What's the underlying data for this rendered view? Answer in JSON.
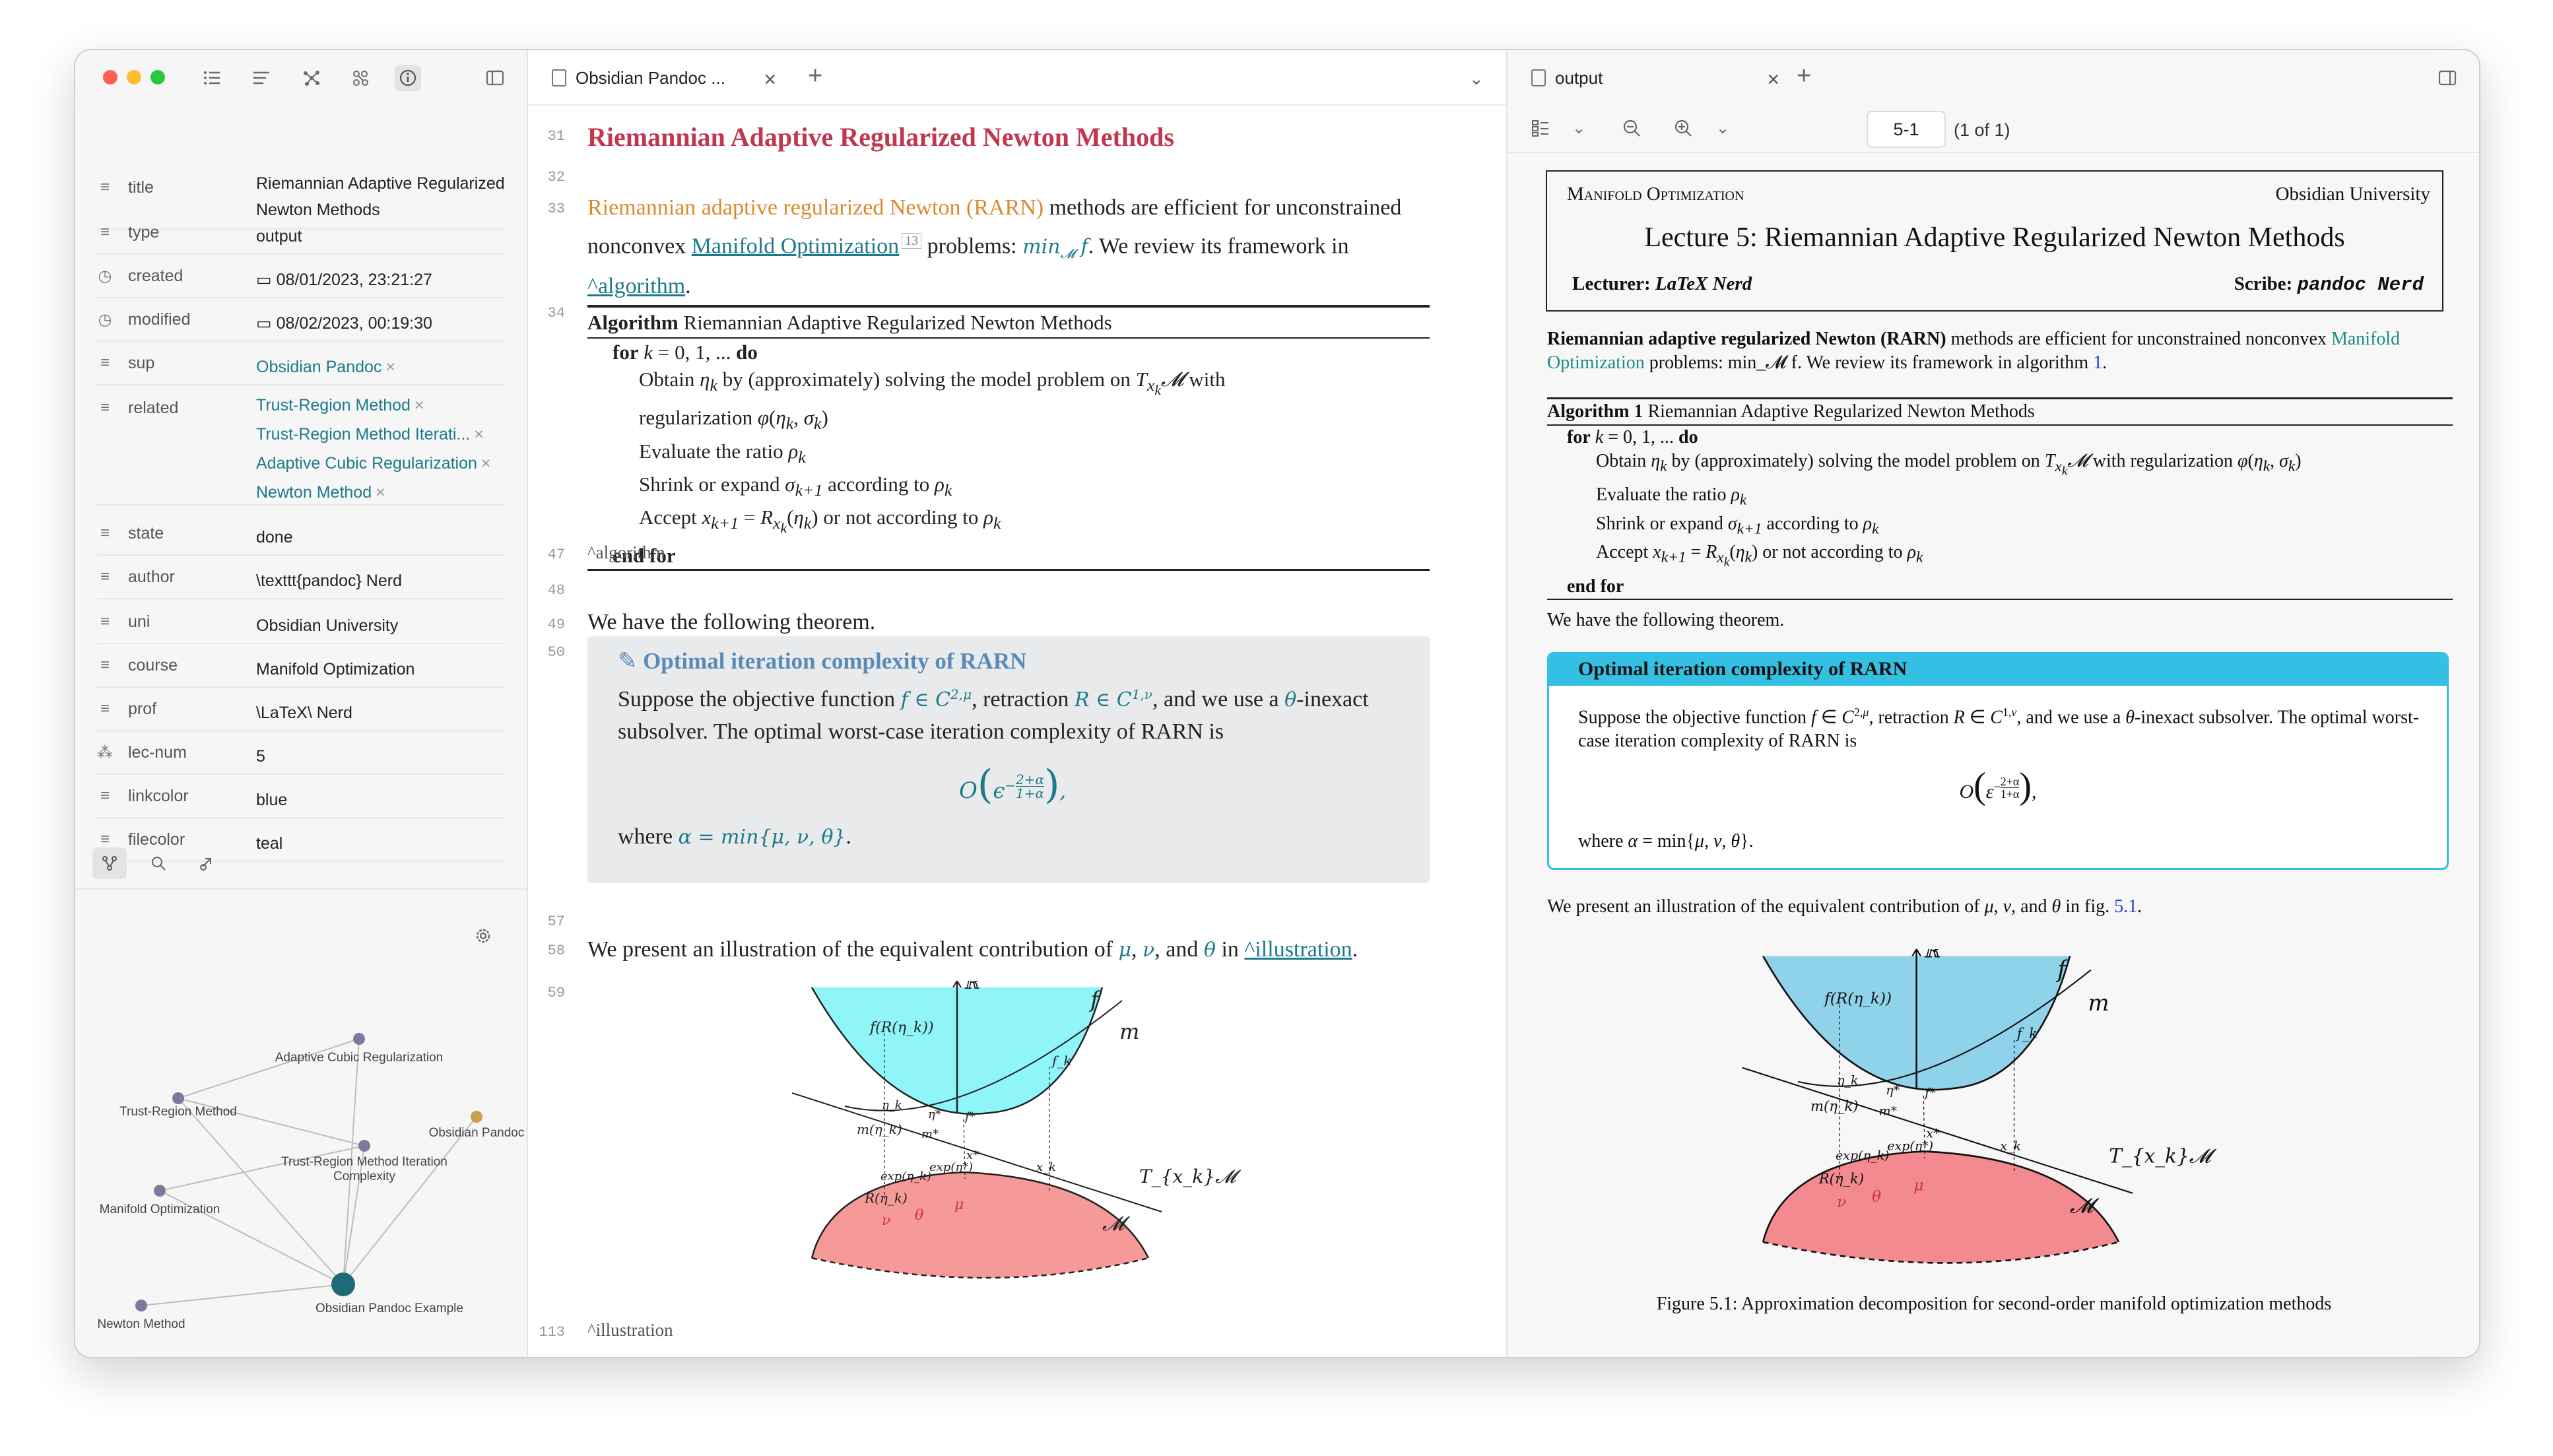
{
  "window": {
    "controls": [
      "close",
      "minimize",
      "zoom"
    ]
  },
  "left_toolbar": {
    "icons": [
      "bullet-list-icon",
      "outline-icon",
      "graph-icon",
      "local-graph-icon",
      "info-icon",
      "sidebar-toggle-icon"
    ]
  },
  "properties": [
    {
      "key": "title",
      "value": "Riemannian Adaptive Regularized Newton Methods",
      "icon": "text-icon"
    },
    {
      "key": "type",
      "value": "output",
      "icon": "text-icon"
    },
    {
      "key": "created",
      "value": "08/01/2023, 23:21:27",
      "icon": "clock-icon"
    },
    {
      "key": "modified",
      "value": "08/02/2023, 00:19:30",
      "icon": "clock-icon"
    },
    {
      "key": "sup",
      "value": "Obsidian Pandoc",
      "icon": "list-icon"
    },
    {
      "key": "related",
      "icon": "list-icon",
      "values": [
        "Trust-Region Method",
        "Trust-Region Method Iterati...",
        "Adaptive Cubic Regularization",
        "Newton Method"
      ]
    },
    {
      "key": "state",
      "value": "done",
      "icon": "text-icon"
    },
    {
      "key": "author",
      "value": "\\texttt{pandoc} Nerd",
      "icon": "text-icon"
    },
    {
      "key": "uni",
      "value": "Obsidian University",
      "icon": "text-icon"
    },
    {
      "key": "course",
      "value": "Manifold Optimization",
      "icon": "text-icon"
    },
    {
      "key": "prof",
      "value": "\\LaTeX\\ Nerd",
      "icon": "text-icon"
    },
    {
      "key": "lec-num",
      "value": "5",
      "icon": "number-icon"
    },
    {
      "key": "linkcolor",
      "value": "blue",
      "icon": "text-icon"
    },
    {
      "key": "filecolor",
      "value": "teal",
      "icon": "text-icon"
    }
  ],
  "graph": {
    "nodes": [
      {
        "label": "Adaptive Cubic Regularization",
        "color": "#7a7a9a"
      },
      {
        "label": "Trust-Region Method",
        "color": "#7a7a9a"
      },
      {
        "label": "Obsidian Pandoc",
        "color": "#c9a04c"
      },
      {
        "label": "Trust-Region Method Iteration Complexity",
        "color": "#7a7a9a"
      },
      {
        "label": "Manifold Optimization",
        "color": "#7a7a9a"
      },
      {
        "label": "Obsidian Pandoc Example",
        "color": "#1d6b78"
      },
      {
        "label": "Newton Method",
        "color": "#7a7a9a"
      }
    ]
  },
  "editor": {
    "tab_title": "Obsidian Pandoc ...",
    "line_numbers": [
      "31",
      "32",
      "33",
      "34",
      "47",
      "48",
      "49",
      "50",
      "57",
      "58",
      "59",
      "113"
    ],
    "heading": "Riemannian Adaptive Regularized Newton Methods",
    "intro_highlight": "Riemannian adaptive regularized Newton (RARN)",
    "intro_rest": " methods are efficient for unconstrained nonconvex ",
    "intro_link": "Manifold Optimization",
    "intro_sup": "13",
    "intro_problems": " problems: ",
    "intro_math": "min",
    "intro_math_sub": "𝓜",
    "intro_f": "f",
    "intro_tail": ". We review its framework in ",
    "intro_ref": "^algorithm",
    "algorithm_label": "Algorithm",
    "algorithm_title": "Riemannian Adaptive Regularized Newton Methods",
    "algo_lines": [
      "for k = 0, 1, ... do",
      "Obtain η_k by (approximately) solving the model problem on T_{x_k}𝓜 with",
      "regularization φ(η_k, σ_k)",
      "Evaluate the ratio ρ_k",
      "Shrink or expand σ_{k+1} according to ρ_k",
      "Accept x_{k+1} = R_{x_k}(η_k) or not according to ρ_k",
      "end for"
    ],
    "algo_anchor": "^algorithm",
    "theorem_intro": "We have the following theorem.",
    "callout_title": "Optimal iteration complexity of RARN",
    "callout_text": "Suppose the objective function f ∈ C^{2,μ}, retraction R ∈ C^{1,ν}, and we use a θ-inexact subsolver. The optimal worst-case iteration complexity of RARN is",
    "callout_formula": "O(ε^{-(2+α)/(1+α)}),",
    "callout_where": "where α = min{μ, ν, θ}.",
    "illustration_text": "We present an illustration of the equivalent contribution of μ, ν, and θ in",
    "illustration_ref": "^illustration",
    "illustration_anchor": "^illustration"
  },
  "figure_labels": {
    "R": "ℝ",
    "f": "f",
    "m": "m",
    "fRk": "f(R(η_k))",
    "fk": "f_k",
    "fstar": "f*",
    "etak": "η_k",
    "etastar": "η*",
    "metak": "m(η_k)",
    "mstar": "m*",
    "expk": "exp(η_k)",
    "expstar": "exp(η*)",
    "xstar": "x*",
    "xk": "x_k",
    "Rk": "R(η_k)",
    "nu": "ν",
    "theta": "θ",
    "mu": "μ",
    "tangent": "T_{x_k}𝓜",
    "manifold": "𝓜"
  },
  "pdf": {
    "tab_title": "output",
    "page_input": "5-1",
    "page_count": "(1 of 1)",
    "course": "Manifold Optimization",
    "uni": "Obsidian University",
    "lecture_title": "Lecture 5: Riemannian Adaptive Regularized Newton Methods",
    "lecturer_label": "Lecturer:",
    "lecturer": "LaTeX Nerd",
    "scribe_label": "Scribe:",
    "scribe": "pandoc Nerd",
    "intro_bold": "Riemannian adaptive regularized Newton (RARN)",
    "intro_rest": " methods are efficient for unconstrained nonconvex ",
    "intro_link": "Manifold Optimization",
    "intro_tail": " problems: min_𝓜 f. We review its framework in algorithm ",
    "intro_ref": "1",
    "algorithm_label": "Algorithm 1",
    "algorithm_title": "Riemannian Adaptive Regularized Newton Methods",
    "algo_lines": [
      "for k = 0, 1, ... do",
      "Obtain η_k by (approximately) solving the model problem on T_{x_k}𝓜 with regularization φ(η_k, σ_k)",
      "Evaluate the ratio ρ_k",
      "Shrink or expand σ_{k+1} according to ρ_k",
      "Accept x_{k+1} = R_{x_k}(η_k) or not according to ρ_k",
      "end for"
    ],
    "theorem_intro": "We have the following theorem.",
    "thm_title": "Optimal iteration complexity of RARN",
    "thm_text": "Suppose the objective function f ∈ C^{2,μ}, retraction R ∈ C^{1,ν}, and we use a θ-inexact subsolver. The optimal worst-case iteration complexity of RARN is",
    "thm_formula": "O(ε^{-(2+α)/(1+α)}),",
    "thm_where": "where α = min{μ, ν, θ}.",
    "illustration_text": "We present an illustration of the equivalent contribution of μ, ν, and θ in fig. ",
    "illustration_ref": "5.1",
    "caption": "Figure 5.1:  Approximation decomposition for second-order manifold optimization methods"
  },
  "colors": {
    "accent": "#1c7a8c",
    "heading": "#c0384f",
    "highlight": "#d98b2c",
    "callout_title": "#5a8bb8",
    "thm_box": "#33c0e2",
    "cyan_fill": "#8ff5f9",
    "red_fill": "#f59a98"
  }
}
